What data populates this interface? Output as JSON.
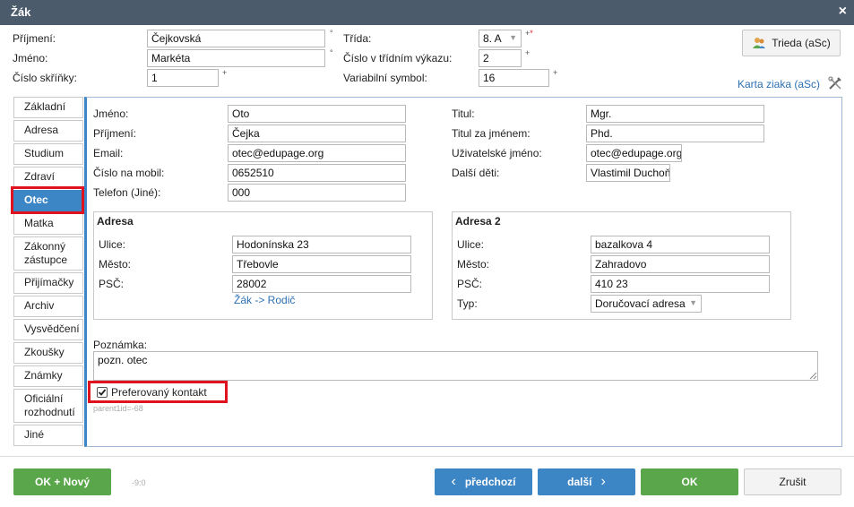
{
  "window": {
    "title": "Žák",
    "close_icon": "×"
  },
  "student": {
    "surname_label": "Příjmení:",
    "surname": "Čejkovská",
    "firstname_label": "Jméno:",
    "firstname": "Markéta",
    "locker_label": "Číslo skříňky:",
    "locker": "1",
    "class_label": "Třída:",
    "class_value": "8. A",
    "class_number_label": "Číslo v třídním výkazu:",
    "class_number": "2",
    "varsym_label": "Variabilní symbol:",
    "varsym": "16",
    "degree_mark": "°",
    "plus_mark": "+",
    "required_mark": "*"
  },
  "header_buttons": {
    "trieda": "Trieda (aSc)",
    "karta": "Karta ziaka (aSc)"
  },
  "tabs": [
    {
      "label": "Základní"
    },
    {
      "label": "Adresa"
    },
    {
      "label": "Studium"
    },
    {
      "label": "Zdraví"
    },
    {
      "label": "Otec"
    },
    {
      "label": "Matka"
    },
    {
      "label": "Zákonný zástupce"
    },
    {
      "label": "Přijímačky"
    },
    {
      "label": "Archiv"
    },
    {
      "label": "Vysvědčení"
    },
    {
      "label": "Zkoušky"
    },
    {
      "label": "Známky"
    },
    {
      "label": "Oficiální rozhodnutí"
    },
    {
      "label": "Jiné"
    }
  ],
  "father": {
    "name_label": "Jméno:",
    "name": "Oto",
    "surname_label": "Příjmení:",
    "surname": "Čejka",
    "email_label": "Email:",
    "email": "otec@edupage.org",
    "mobile_label": "Číslo na mobil:",
    "mobile": "0652510",
    "phone_label": "Telefon (Jiné):",
    "phone": "000",
    "title_label": "Titul:",
    "title": "Mgr.",
    "title_after_label": "Titul za jménem:",
    "title_after": "Phd.",
    "username_label": "Uživatelské jméno:",
    "username": "otec@edupage.org",
    "children_label": "Další děti:",
    "children": "Vlastimil Duchoň"
  },
  "address1": {
    "title": "Adresa",
    "street_label": "Ulice:",
    "street": "Hodonínska 23",
    "city_label": "Město:",
    "city": "Třebovle",
    "zip_label": "PSČ:",
    "zip": "28002",
    "copy_link": "Žák -> Rodič"
  },
  "address2": {
    "title": "Adresa 2",
    "street_label": "Ulice:",
    "street": "bazalkova 4",
    "city_label": "Město:",
    "city": "Zahradovo",
    "zip_label": "PSČ:",
    "zip": "410 23",
    "type_label": "Typ:",
    "type": "Doručovací adresa"
  },
  "note": {
    "label": "Poznámka:",
    "value": "pozn. otec"
  },
  "preferred": {
    "label": "Preferovaný kontakt",
    "checked": true
  },
  "parent_id": "parent1id=-68",
  "footer": {
    "ok_new": "OK + Nový",
    "counter": "-9:0",
    "prev": "předchozí",
    "next": "další",
    "ok": "OK",
    "cancel": "Zrušit"
  },
  "colors": {
    "titlebar": "#4b5b6c",
    "accent_blue": "#3d86c6",
    "green": "#5aa64a",
    "highlight_red": "#e0121f"
  }
}
